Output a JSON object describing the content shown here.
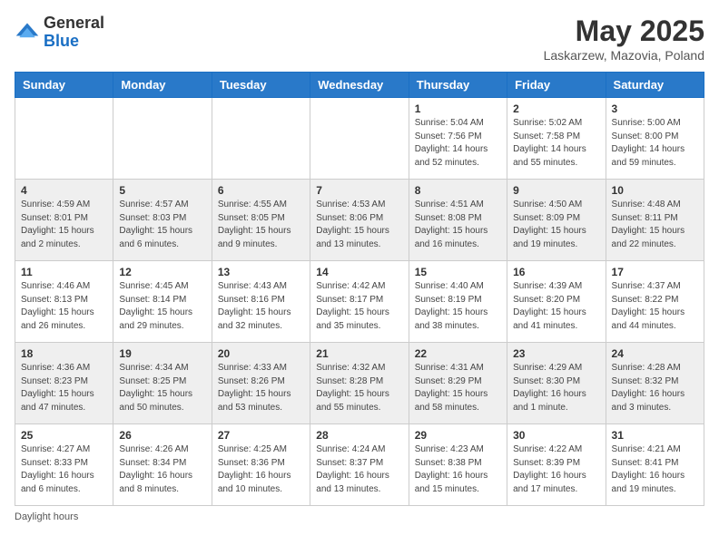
{
  "header": {
    "logo_general": "General",
    "logo_blue": "Blue",
    "month_title": "May 2025",
    "location": "Laskarzew, Mazovia, Poland"
  },
  "days_of_week": [
    "Sunday",
    "Monday",
    "Tuesday",
    "Wednesday",
    "Thursday",
    "Friday",
    "Saturday"
  ],
  "weeks": [
    [
      {
        "day": "",
        "info": ""
      },
      {
        "day": "",
        "info": ""
      },
      {
        "day": "",
        "info": ""
      },
      {
        "day": "",
        "info": ""
      },
      {
        "day": "1",
        "info": "Sunrise: 5:04 AM\nSunset: 7:56 PM\nDaylight: 14 hours\nand 52 minutes."
      },
      {
        "day": "2",
        "info": "Sunrise: 5:02 AM\nSunset: 7:58 PM\nDaylight: 14 hours\nand 55 minutes."
      },
      {
        "day": "3",
        "info": "Sunrise: 5:00 AM\nSunset: 8:00 PM\nDaylight: 14 hours\nand 59 minutes."
      }
    ],
    [
      {
        "day": "4",
        "info": "Sunrise: 4:59 AM\nSunset: 8:01 PM\nDaylight: 15 hours\nand 2 minutes."
      },
      {
        "day": "5",
        "info": "Sunrise: 4:57 AM\nSunset: 8:03 PM\nDaylight: 15 hours\nand 6 minutes."
      },
      {
        "day": "6",
        "info": "Sunrise: 4:55 AM\nSunset: 8:05 PM\nDaylight: 15 hours\nand 9 minutes."
      },
      {
        "day": "7",
        "info": "Sunrise: 4:53 AM\nSunset: 8:06 PM\nDaylight: 15 hours\nand 13 minutes."
      },
      {
        "day": "8",
        "info": "Sunrise: 4:51 AM\nSunset: 8:08 PM\nDaylight: 15 hours\nand 16 minutes."
      },
      {
        "day": "9",
        "info": "Sunrise: 4:50 AM\nSunset: 8:09 PM\nDaylight: 15 hours\nand 19 minutes."
      },
      {
        "day": "10",
        "info": "Sunrise: 4:48 AM\nSunset: 8:11 PM\nDaylight: 15 hours\nand 22 minutes."
      }
    ],
    [
      {
        "day": "11",
        "info": "Sunrise: 4:46 AM\nSunset: 8:13 PM\nDaylight: 15 hours\nand 26 minutes."
      },
      {
        "day": "12",
        "info": "Sunrise: 4:45 AM\nSunset: 8:14 PM\nDaylight: 15 hours\nand 29 minutes."
      },
      {
        "day": "13",
        "info": "Sunrise: 4:43 AM\nSunset: 8:16 PM\nDaylight: 15 hours\nand 32 minutes."
      },
      {
        "day": "14",
        "info": "Sunrise: 4:42 AM\nSunset: 8:17 PM\nDaylight: 15 hours\nand 35 minutes."
      },
      {
        "day": "15",
        "info": "Sunrise: 4:40 AM\nSunset: 8:19 PM\nDaylight: 15 hours\nand 38 minutes."
      },
      {
        "day": "16",
        "info": "Sunrise: 4:39 AM\nSunset: 8:20 PM\nDaylight: 15 hours\nand 41 minutes."
      },
      {
        "day": "17",
        "info": "Sunrise: 4:37 AM\nSunset: 8:22 PM\nDaylight: 15 hours\nand 44 minutes."
      }
    ],
    [
      {
        "day": "18",
        "info": "Sunrise: 4:36 AM\nSunset: 8:23 PM\nDaylight: 15 hours\nand 47 minutes."
      },
      {
        "day": "19",
        "info": "Sunrise: 4:34 AM\nSunset: 8:25 PM\nDaylight: 15 hours\nand 50 minutes."
      },
      {
        "day": "20",
        "info": "Sunrise: 4:33 AM\nSunset: 8:26 PM\nDaylight: 15 hours\nand 53 minutes."
      },
      {
        "day": "21",
        "info": "Sunrise: 4:32 AM\nSunset: 8:28 PM\nDaylight: 15 hours\nand 55 minutes."
      },
      {
        "day": "22",
        "info": "Sunrise: 4:31 AM\nSunset: 8:29 PM\nDaylight: 15 hours\nand 58 minutes."
      },
      {
        "day": "23",
        "info": "Sunrise: 4:29 AM\nSunset: 8:30 PM\nDaylight: 16 hours\nand 1 minute."
      },
      {
        "day": "24",
        "info": "Sunrise: 4:28 AM\nSunset: 8:32 PM\nDaylight: 16 hours\nand 3 minutes."
      }
    ],
    [
      {
        "day": "25",
        "info": "Sunrise: 4:27 AM\nSunset: 8:33 PM\nDaylight: 16 hours\nand 6 minutes."
      },
      {
        "day": "26",
        "info": "Sunrise: 4:26 AM\nSunset: 8:34 PM\nDaylight: 16 hours\nand 8 minutes."
      },
      {
        "day": "27",
        "info": "Sunrise: 4:25 AM\nSunset: 8:36 PM\nDaylight: 16 hours\nand 10 minutes."
      },
      {
        "day": "28",
        "info": "Sunrise: 4:24 AM\nSunset: 8:37 PM\nDaylight: 16 hours\nand 13 minutes."
      },
      {
        "day": "29",
        "info": "Sunrise: 4:23 AM\nSunset: 8:38 PM\nDaylight: 16 hours\nand 15 minutes."
      },
      {
        "day": "30",
        "info": "Sunrise: 4:22 AM\nSunset: 8:39 PM\nDaylight: 16 hours\nand 17 minutes."
      },
      {
        "day": "31",
        "info": "Sunrise: 4:21 AM\nSunset: 8:41 PM\nDaylight: 16 hours\nand 19 minutes."
      }
    ]
  ],
  "footer": {
    "daylight_label": "Daylight hours"
  }
}
